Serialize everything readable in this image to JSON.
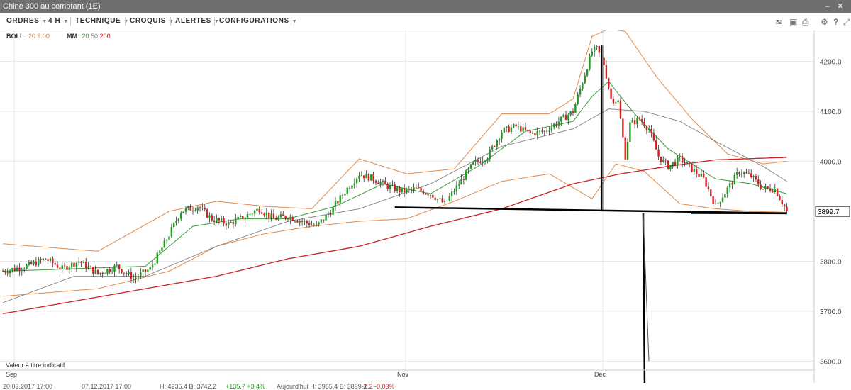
{
  "window": {
    "title": "Chine 300 au comptant (1E)"
  },
  "toolbar": {
    "menus": [
      {
        "label": "ORDRES"
      },
      {
        "label": "4 H"
      },
      {
        "label": "TECHNIQUE"
      },
      {
        "label": "CROQUIS"
      },
      {
        "label": "ALERTES"
      },
      {
        "label": "CONFIGURATIONS"
      }
    ],
    "icons": [
      "layers-icon",
      "image-icon",
      "print-icon",
      "gear-icon",
      "help-icon",
      "fullscreen-icon"
    ]
  },
  "indicators": {
    "boll": {
      "name": "BOLL",
      "p1": "20",
      "p2": "2.00"
    },
    "mm": {
      "name": "MM",
      "p1": "20",
      "p2": "50",
      "p3": "200"
    }
  },
  "disclaimer": "Valeur à titre indicatif",
  "status": {
    "from": "20.09.2017 17:00",
    "to": "07.12.2017 17:00",
    "ohlc": "H: 4235.4 B: 3742.2",
    "change": "+135.7 +3.4%",
    "today": "Aujourd'hui H: 3965.4 B: 3899.2",
    "today_change": "-1.2 -0.03%"
  },
  "colors": {
    "up": "#1e9a1e",
    "down": "#d62020",
    "boll": "#e08a4a",
    "ma20": "#3a9a3a",
    "ma50": "#8a8a8a",
    "ma200": "#cc2222",
    "grid": "#e6e6e6"
  },
  "chart_data": {
    "type": "line",
    "y_ticks": [
      "4200.0",
      "4100.0",
      "4000.0",
      "3800.0",
      "3700.0",
      "3600.0"
    ],
    "ylim": [
      3582,
      4262
    ],
    "x_labels": [
      "Sep",
      "Nov",
      "Déc"
    ],
    "last_price": "3899.7",
    "series": [
      {
        "name": "BOLL 20 2.00",
        "key": "boll"
      },
      {
        "name": "MM 20",
        "key": "ma20"
      },
      {
        "name": "MM 50",
        "key": "ma50"
      },
      {
        "name": "MM 200",
        "key": "ma200"
      }
    ],
    "price_path": [
      [
        0,
        3780
      ],
      [
        10,
        3790
      ],
      [
        18,
        3805
      ],
      [
        25,
        3785
      ],
      [
        32,
        3800
      ],
      [
        40,
        3775
      ],
      [
        48,
        3790
      ],
      [
        55,
        3765
      ],
      [
        62,
        3785
      ],
      [
        68,
        3835
      ],
      [
        75,
        3900
      ],
      [
        82,
        3910
      ],
      [
        88,
        3885
      ],
      [
        95,
        3875
      ],
      [
        102,
        3890
      ],
      [
        108,
        3905
      ],
      [
        114,
        3885
      ],
      [
        120,
        3890
      ],
      [
        126,
        3880
      ],
      [
        132,
        3870
      ],
      [
        138,
        3900
      ],
      [
        144,
        3940
      ],
      [
        150,
        3975
      ],
      [
        156,
        3965
      ],
      [
        162,
        3950
      ],
      [
        168,
        3940
      ],
      [
        174,
        3945
      ],
      [
        180,
        3935
      ],
      [
        186,
        3915
      ],
      [
        192,
        3955
      ],
      [
        198,
        3995
      ],
      [
        204,
        4010
      ],
      [
        210,
        4060
      ],
      [
        216,
        4070
      ],
      [
        222,
        4055
      ],
      [
        228,
        4060
      ],
      [
        234,
        4080
      ],
      [
        240,
        4100
      ],
      [
        244,
        4160
      ],
      [
        248,
        4220
      ],
      [
        250,
        4225
      ],
      [
        253,
        4195
      ],
      [
        256,
        4125
      ],
      [
        259,
        4120
      ],
      [
        262,
        4010
      ],
      [
        264,
        4075
      ],
      [
        268,
        4085
      ],
      [
        272,
        4065
      ],
      [
        276,
        4010
      ],
      [
        280,
        3990
      ],
      [
        285,
        4005
      ],
      [
        290,
        3985
      ],
      [
        295,
        3965
      ],
      [
        300,
        3910
      ],
      [
        305,
        3945
      ],
      [
        310,
        3980
      ],
      [
        315,
        3970
      ],
      [
        320,
        3945
      ],
      [
        325,
        3945
      ],
      [
        330,
        3900
      ]
    ],
    "ma200_path": [
      [
        0,
        3695
      ],
      [
        30,
        3720
      ],
      [
        60,
        3745
      ],
      [
        90,
        3770
      ],
      [
        120,
        3805
      ],
      [
        150,
        3830
      ],
      [
        180,
        3870
      ],
      [
        210,
        3905
      ],
      [
        240,
        3955
      ],
      [
        260,
        3975
      ],
      [
        280,
        3990
      ],
      [
        300,
        4003
      ],
      [
        330,
        4008
      ]
    ],
    "ma50_path": [
      [
        0,
        3717
      ],
      [
        30,
        3770
      ],
      [
        60,
        3770
      ],
      [
        90,
        3830
      ],
      [
        120,
        3880
      ],
      [
        150,
        3905
      ],
      [
        180,
        3955
      ],
      [
        210,
        4030
      ],
      [
        240,
        4065
      ],
      [
        255,
        4105
      ],
      [
        270,
        4100
      ],
      [
        285,
        4080
      ],
      [
        300,
        4040
      ],
      [
        320,
        3990
      ],
      [
        330,
        3960
      ]
    ],
    "ma20_path": [
      [
        0,
        3780
      ],
      [
        30,
        3785
      ],
      [
        60,
        3790
      ],
      [
        80,
        3870
      ],
      [
        100,
        3885
      ],
      [
        120,
        3885
      ],
      [
        140,
        3910
      ],
      [
        160,
        3955
      ],
      [
        180,
        3935
      ],
      [
        200,
        3990
      ],
      [
        220,
        4060
      ],
      [
        240,
        4080
      ],
      [
        248,
        4130
      ],
      [
        255,
        4160
      ],
      [
        265,
        4100
      ],
      [
        280,
        4025
      ],
      [
        300,
        3965
      ],
      [
        315,
        3955
      ],
      [
        330,
        3935
      ]
    ],
    "boll_upper_path": [
      [
        0,
        3835
      ],
      [
        40,
        3820
      ],
      [
        70,
        3900
      ],
      [
        90,
        3920
      ],
      [
        110,
        3910
      ],
      [
        130,
        3905
      ],
      [
        150,
        4005
      ],
      [
        170,
        3975
      ],
      [
        190,
        3985
      ],
      [
        210,
        4095
      ],
      [
        230,
        4095
      ],
      [
        240,
        4125
      ],
      [
        248,
        4250
      ],
      [
        255,
        4265
      ],
      [
        262,
        4260
      ],
      [
        275,
        4170
      ],
      [
        290,
        4085
      ],
      [
        305,
        4015
      ],
      [
        320,
        3995
      ],
      [
        330,
        4000
      ]
    ],
    "boll_lower_path": [
      [
        0,
        3730
      ],
      [
        40,
        3745
      ],
      [
        70,
        3780
      ],
      [
        90,
        3830
      ],
      [
        110,
        3855
      ],
      [
        130,
        3870
      ],
      [
        150,
        3880
      ],
      [
        170,
        3885
      ],
      [
        190,
        3920
      ],
      [
        210,
        3960
      ],
      [
        230,
        3975
      ],
      [
        248,
        3925
      ],
      [
        258,
        3995
      ],
      [
        270,
        3980
      ],
      [
        285,
        3915
      ],
      [
        300,
        3905
      ],
      [
        315,
        3900
      ],
      [
        330,
        3898
      ]
    ],
    "neckline": [
      [
        165,
        3908
      ],
      [
        330,
        3896
      ]
    ],
    "head_drop": [
      [
        252,
        4232
      ],
      [
        252,
        3900
      ]
    ],
    "target_drop": [
      [
        323,
        3896
      ],
      [
        325,
        3586
      ]
    ]
  }
}
